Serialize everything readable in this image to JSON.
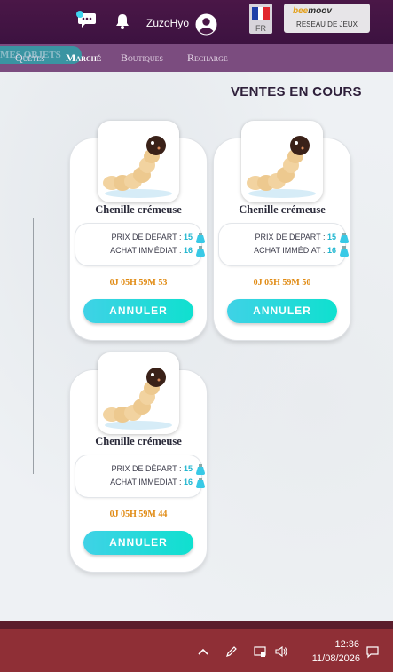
{
  "header": {
    "username": "ZuzoHyo",
    "language": "FR",
    "partner_logo_a": "bee",
    "partner_logo_b": "moov",
    "partner_sub": "RESEAU DE JEUX"
  },
  "nav": {
    "ghost_label": "MES OBJETS",
    "items": [
      "Quêtes",
      "Marché",
      "Boutiques",
      "Recharge"
    ],
    "active": "Marché"
  },
  "main": {
    "title": "VENTES EN COURS"
  },
  "sales": [
    {
      "name": "Chenille crémeuse",
      "start_label": "PRIX DE DÉPART :",
      "start_value": "15",
      "buy_label": "ACHAT IMMÉDIAT :",
      "buy_value": "16",
      "timer": "0J 05H 59M 53",
      "button": "ANNULER"
    },
    {
      "name": "Chenille crémeuse",
      "start_label": "PRIX DE DÉPART :",
      "start_value": "15",
      "buy_label": "ACHAT IMMÉDIAT :",
      "buy_value": "16",
      "timer": "0J 05H 59M 50",
      "button": "ANNULER"
    },
    {
      "name": "Chenille crémeuse",
      "start_label": "PRIX DE DÉPART :",
      "start_value": "15",
      "buy_label": "ACHAT IMMÉDIAT :",
      "buy_value": "16",
      "timer": "0J 05H 59M 44",
      "button": "ANNULER"
    }
  ],
  "taskbar": {
    "time": "12:36",
    "date": "11/08/2026",
    "icons": [
      "chevron-up-icon",
      "pen-icon",
      "network-icon",
      "volume-icon",
      "notification-icon"
    ]
  },
  "colors": {
    "header": "#3c1240",
    "nav": "#7b4c7f",
    "accent": "#1fb6d0",
    "timer": "#e08a12",
    "taskbar": "#8f2f36"
  }
}
